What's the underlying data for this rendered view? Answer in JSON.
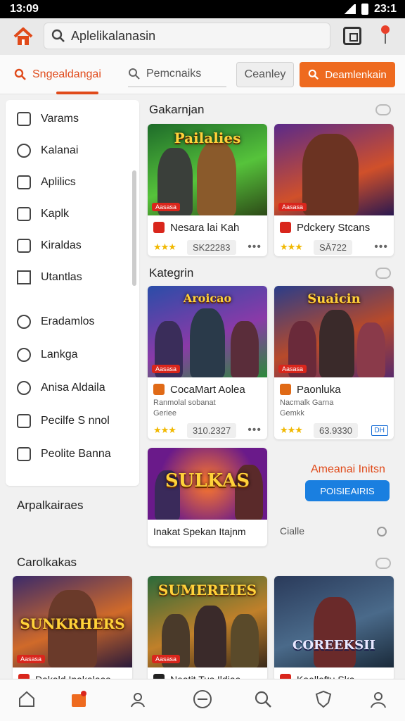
{
  "status": {
    "time": "13:09",
    "battery": "23:1"
  },
  "search": {
    "value": "Aplelikalanasin"
  },
  "tabs": [
    {
      "label": "Sngealdangai"
    },
    {
      "label": "Pemcnaiks"
    },
    {
      "label": "Ceanley"
    },
    {
      "label": "Deamlenkain"
    }
  ],
  "sidebar": {
    "items": [
      {
        "label": "Varams",
        "icon": "grid-icon"
      },
      {
        "label": "Kalanai",
        "icon": "user-icon"
      },
      {
        "label": "Aplilics",
        "icon": "app-icon"
      },
      {
        "label": "Kaplk",
        "icon": "edit-icon"
      },
      {
        "label": "Kiraldas",
        "icon": "tag-icon"
      },
      {
        "label": "Utantlas",
        "icon": "square-icon"
      },
      {
        "label": "Eradamlos",
        "icon": "clock-icon"
      },
      {
        "label": "Lankga",
        "icon": "location-icon"
      },
      {
        "label": "Anisa Aldaila",
        "icon": "info-icon"
      },
      {
        "label": "Pecilfe S nnol",
        "icon": "cloud-icon"
      },
      {
        "label": "Peolite Banna",
        "icon": "edit-box-icon"
      }
    ],
    "section_a": "Arpalkairaes",
    "section_b": "Carolkakas"
  },
  "sections": {
    "top": "Gakarnjan",
    "middle": "Kategrin"
  },
  "cards": [
    {
      "thumb": "Pailalies",
      "badge": "Aasasa",
      "name": "Nesara lai Kah",
      "rating": "★★★",
      "count": "SK22283"
    },
    {
      "thumb": "",
      "badge": "Aasasa",
      "name": "Pdckery Stcans",
      "rating": "★★★",
      "count": "SĀ722"
    },
    {
      "thumb": "Aroicao",
      "badge": "Aasasa",
      "name": "CocaMart Aolea",
      "sub1": "Ranmolal sobanat",
      "sub2": "Geriee",
      "rating": "★★★",
      "count": "310.2327"
    },
    {
      "thumb": "Suaicin",
      "badge": "Aasasa",
      "name": "Paonluka",
      "sub1": "Nacmalk Garna",
      "sub2": "Gemkk",
      "rating": "★★★",
      "count": "63.9330",
      "tag": "DH"
    },
    {
      "thumb": "SULKAS",
      "caption": "Inakat Spekan Itajnm"
    },
    {
      "thumb": "SUNKRHERS",
      "badge": "Aasasa",
      "name": "Dakald Inakalaas"
    },
    {
      "thumb": "SUMEREIES",
      "badge": "Aasasa",
      "name": "Neatit Tus Ildiaa"
    },
    {
      "thumb": "COREEKSII",
      "name": "Kaelleftu Ska"
    }
  ],
  "promo": {
    "title": "Ameanai Initsn",
    "button": "POISIEAIRIS",
    "caption": "Cialle"
  },
  "colors": {
    "accent": "#ee6a1f",
    "accent_text": "#e04a1a",
    "link": "#1a7fe0"
  }
}
